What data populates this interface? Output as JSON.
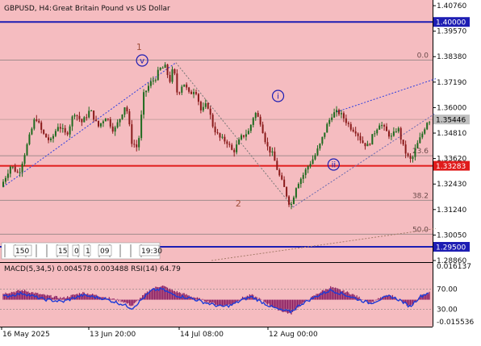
{
  "header": {
    "symbol": "GBPUSD, H4:",
    "description": "Great Britain Pound vs US Dollar"
  },
  "colors": {
    "main_bg": "#f5bcc0",
    "macd_bg": "#f5bcc0",
    "candle_up": "#1e6a1e",
    "candle_down": "#8a1a1a",
    "level_blue": "#1d1db3",
    "level_red": "#e01b1b",
    "fib_line": "#a08c8c",
    "trend_dotted": "#2d3ee0",
    "wave_channel": "#888888",
    "long_trend": "#a67c6a",
    "rsi_line": "#1e3bd8",
    "macd_fill": "#8c1f63",
    "wave_label": "#a0503c",
    "circle_label": "#1d1db3"
  },
  "price_axis": {
    "labels": [
      "1.40760",
      "1.39570",
      "1.38380",
      "1.37190",
      "1.36000",
      "1.34810",
      "1.33620",
      "1.32430",
      "1.31240",
      "1.30050",
      "1.28860"
    ],
    "min": 1.2886,
    "max": 1.4095
  },
  "levels": [
    {
      "name": "level-1-40000",
      "price": 1.4,
      "label": "1.40000",
      "kind": "blue"
    },
    {
      "name": "level-1-33283",
      "price": 1.33283,
      "label": "1.33283",
      "kind": "red"
    },
    {
      "name": "level-1-29500",
      "price": 1.295,
      "label": "1.29500",
      "kind": "blue"
    }
  ],
  "current_price": {
    "price": 1.35446,
    "label": "1.35446"
  },
  "fib_levels": [
    {
      "label": "0.0",
      "price": 1.3822
    },
    {
      "label": "23.6",
      "price": 1.3375
    },
    {
      "label": "38.2",
      "price": 1.3167
    },
    {
      "label": "50.0",
      "price": 1.3009
    }
  ],
  "wave_labels": [
    {
      "text": "1",
      "type": "plain"
    },
    {
      "text": "2",
      "type": "plain"
    },
    {
      "text": "v",
      "type": "circle"
    },
    {
      "text": "i",
      "type": "circle"
    },
    {
      "text": "ii",
      "type": "circle"
    }
  ],
  "time_axis": {
    "labels": [
      "16 May 2025",
      "13 Jun 20:00",
      "14 Jul 08:00",
      "12 Aug 00:00"
    ]
  },
  "toolbar_fragments": [
    "150",
    "15",
    "0",
    "1",
    "09",
    "19:30"
  ],
  "indicator": {
    "label": "MACD(5,34,5) 0.004578 0.003488 RSI(14) 64.79",
    "axis_labels": [
      "0.016137",
      "70.00",
      "30.00",
      "-0.015536"
    ]
  },
  "chart_data": {
    "type": "candlestick",
    "symbol": "GBPUSD",
    "timeframe": "H4",
    "x_axis_labels": [
      "16 May 2025",
      "13 Jun 20:00",
      "14 Jul 08:00",
      "12 Aug 00:00"
    ],
    "ylim": [
      1.2886,
      1.4095
    ],
    "price_path": [
      [
        0,
        1.323
      ],
      [
        10,
        1.333
      ],
      [
        18,
        1.329
      ],
      [
        28,
        1.345
      ],
      [
        35,
        1.356
      ],
      [
        42,
        1.348
      ],
      [
        50,
        1.344
      ],
      [
        58,
        1.352
      ],
      [
        66,
        1.347
      ],
      [
        74,
        1.358
      ],
      [
        82,
        1.353
      ],
      [
        90,
        1.359
      ],
      [
        98,
        1.351
      ],
      [
        106,
        1.356
      ],
      [
        114,
        1.349
      ],
      [
        120,
        1.355
      ],
      [
        126,
        1.362
      ],
      [
        132,
        1.344
      ],
      [
        138,
        1.341
      ],
      [
        144,
        1.366
      ],
      [
        150,
        1.371
      ],
      [
        156,
        1.374
      ],
      [
        160,
        1.378
      ],
      [
        166,
        1.379
      ],
      [
        170,
        1.372
      ],
      [
        174,
        1.379
      ],
      [
        178,
        1.366
      ],
      [
        184,
        1.372
      ],
      [
        190,
        1.366
      ],
      [
        196,
        1.369
      ],
      [
        202,
        1.358
      ],
      [
        208,
        1.362
      ],
      [
        214,
        1.351
      ],
      [
        220,
        1.346
      ],
      [
        228,
        1.344
      ],
      [
        234,
        1.339
      ],
      [
        242,
        1.346
      ],
      [
        250,
        1.349
      ],
      [
        256,
        1.358
      ],
      [
        262,
        1.353
      ],
      [
        268,
        1.342
      ],
      [
        274,
        1.338
      ],
      [
        280,
        1.329
      ],
      [
        286,
        1.322
      ],
      [
        292,
        1.3135
      ],
      [
        298,
        1.324
      ],
      [
        304,
        1.328
      ],
      [
        310,
        1.333
      ],
      [
        316,
        1.337
      ],
      [
        322,
        1.343
      ],
      [
        328,
        1.351
      ],
      [
        334,
        1.357
      ],
      [
        340,
        1.358
      ],
      [
        346,
        1.355
      ],
      [
        352,
        1.351
      ],
      [
        358,
        1.349
      ],
      [
        364,
        1.344
      ],
      [
        370,
        1.342
      ],
      [
        376,
        1.348
      ],
      [
        382,
        1.353
      ],
      [
        388,
        1.349
      ],
      [
        394,
        1.346
      ],
      [
        400,
        1.351
      ],
      [
        406,
        1.341
      ],
      [
        410,
        1.337
      ],
      [
        414,
        1.335
      ],
      [
        418,
        1.341
      ],
      [
        424,
        1.347
      ],
      [
        430,
        1.354
      ]
    ],
    "macd_histogram_path": [
      [
        0,
        0.004
      ],
      [
        20,
        0.006
      ],
      [
        40,
        0.003
      ],
      [
        60,
        0.001
      ],
      [
        80,
        0.0045
      ],
      [
        100,
        0.002
      ],
      [
        120,
        -0.001
      ],
      [
        130,
        -0.004
      ],
      [
        140,
        0.002
      ],
      [
        150,
        0.007
      ],
      [
        160,
        0.009
      ],
      [
        170,
        0.006
      ],
      [
        180,
        0.004
      ],
      [
        190,
        0.002
      ],
      [
        200,
        0.0
      ],
      [
        210,
        -0.002
      ],
      [
        220,
        -0.004
      ],
      [
        230,
        -0.003
      ],
      [
        240,
        0.001
      ],
      [
        250,
        0.003
      ],
      [
        260,
        0.0
      ],
      [
        270,
        -0.004
      ],
      [
        280,
        -0.007
      ],
      [
        290,
        -0.009
      ],
      [
        300,
        -0.003
      ],
      [
        310,
        0.001
      ],
      [
        320,
        0.005
      ],
      [
        330,
        0.008
      ],
      [
        340,
        0.006
      ],
      [
        350,
        0.004
      ],
      [
        360,
        0.001
      ],
      [
        370,
        -0.002
      ],
      [
        380,
        0.001
      ],
      [
        390,
        0.003
      ],
      [
        400,
        0.0
      ],
      [
        410,
        -0.005
      ],
      [
        420,
        0.002
      ],
      [
        430,
        0.005
      ]
    ],
    "rsi_path": [
      [
        0,
        55
      ],
      [
        20,
        62
      ],
      [
        40,
        50
      ],
      [
        60,
        45
      ],
      [
        80,
        58
      ],
      [
        100,
        52
      ],
      [
        120,
        40
      ],
      [
        130,
        32
      ],
      [
        140,
        50
      ],
      [
        150,
        68
      ],
      [
        160,
        70
      ],
      [
        170,
        60
      ],
      [
        180,
        55
      ],
      [
        190,
        52
      ],
      [
        200,
        45
      ],
      [
        210,
        40
      ],
      [
        220,
        35
      ],
      [
        230,
        38
      ],
      [
        240,
        48
      ],
      [
        250,
        55
      ],
      [
        260,
        45
      ],
      [
        270,
        35
      ],
      [
        280,
        28
      ],
      [
        290,
        25
      ],
      [
        300,
        40
      ],
      [
        310,
        50
      ],
      [
        320,
        60
      ],
      [
        330,
        68
      ],
      [
        340,
        62
      ],
      [
        350,
        55
      ],
      [
        360,
        48
      ],
      [
        370,
        42
      ],
      [
        380,
        50
      ],
      [
        390,
        56
      ],
      [
        400,
        48
      ],
      [
        410,
        35
      ],
      [
        420,
        55
      ],
      [
        430,
        64.79
      ]
    ],
    "rsi_levels": [
      70,
      30
    ],
    "grid": false,
    "legend": "none"
  }
}
